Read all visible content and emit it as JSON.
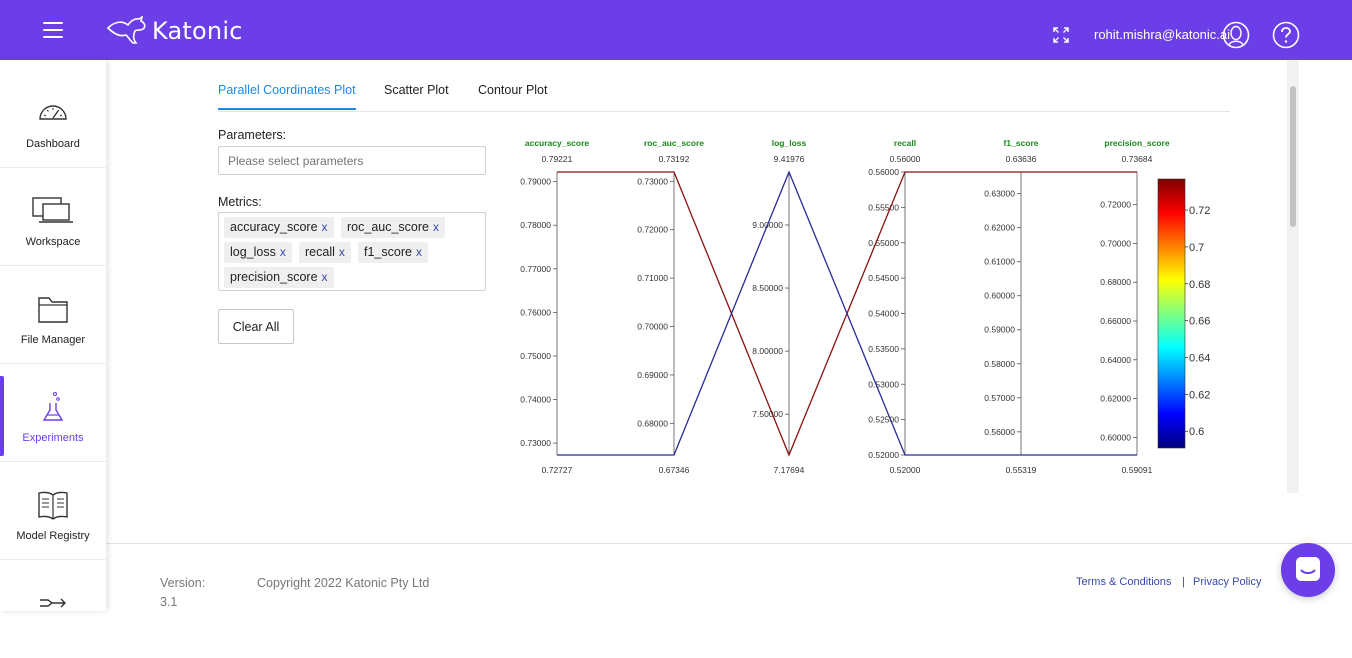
{
  "app": {
    "brand": "Katonic",
    "user_email": "rohit.mishra@katonic.ai",
    "accent_color": "#6c3ee8"
  },
  "icons": {
    "menu": "hamburger-icon",
    "expand": "fullscreen-icon",
    "user": "user-avatar-icon",
    "help": "question-icon",
    "chat": "chat-icon"
  },
  "sidebar": {
    "items": [
      {
        "label": "Dashboard",
        "icon": "gauge-icon",
        "active": false
      },
      {
        "label": "Workspace",
        "icon": "monitor-icon",
        "active": false
      },
      {
        "label": "File Manager",
        "icon": "folder-icon",
        "active": false
      },
      {
        "label": "Experiments",
        "icon": "flask-icon",
        "active": true
      },
      {
        "label": "Model Registry",
        "icon": "book-icon",
        "active": false
      }
    ]
  },
  "tabs": [
    {
      "label": "Parallel Coordinates Plot",
      "active": true
    },
    {
      "label": "Scatter Plot",
      "active": false
    },
    {
      "label": "Contour Plot",
      "active": false
    }
  ],
  "form": {
    "parameters_label": "Parameters:",
    "parameters_placeholder": "Please select parameters",
    "metrics_label": "Metrics:",
    "metrics": [
      "accuracy_score",
      "roc_auc_score",
      "log_loss",
      "recall",
      "f1_score",
      "precision_score"
    ],
    "chip_remove": "x",
    "clear_all": "Clear All"
  },
  "chart_data": {
    "type": "parallel_coordinates",
    "axes": [
      {
        "name": "accuracy_score",
        "max_label": "0.79221",
        "min_label": "0.72727",
        "range": [
          0.72727,
          0.79221
        ],
        "ticks": [
          "0.79000",
          "0.78000",
          "0.77000",
          "0.76000",
          "0.75000",
          "0.74000",
          "0.73000"
        ]
      },
      {
        "name": "roc_auc_score",
        "max_label": "0.73192",
        "min_label": "0.67346",
        "range": [
          0.67346,
          0.73192
        ],
        "ticks": [
          "0.73000",
          "0.72000",
          "0.71000",
          "0.70000",
          "0.69000",
          "0.68000"
        ]
      },
      {
        "name": "log_loss",
        "max_label": "9.41976",
        "min_label": "7.17694",
        "range": [
          7.17694,
          9.41976
        ],
        "ticks": [
          "9.00000",
          "8.50000",
          "8.00000",
          "7.50000"
        ]
      },
      {
        "name": "recall",
        "max_label": "0.56000",
        "min_label": "0.52000",
        "range": [
          0.52,
          0.56
        ],
        "ticks": [
          "0.56000",
          "0.55500",
          "0.55000",
          "0.54500",
          "0.54000",
          "0.53500",
          "0.53000",
          "0.52500",
          "0.52000"
        ]
      },
      {
        "name": "f1_score",
        "max_label": "0.63636",
        "min_label": "0.55319",
        "range": [
          0.55319,
          0.63636
        ],
        "ticks": [
          "0.63000",
          "0.62000",
          "0.61000",
          "0.60000",
          "0.59000",
          "0.58000",
          "0.57000",
          "0.56000"
        ]
      },
      {
        "name": "precision_score",
        "max_label": "0.73684",
        "min_label": "0.59091",
        "range": [
          0.59091,
          0.73684
        ],
        "ticks": [
          "0.72000",
          "0.70000",
          "0.68000",
          "0.66000",
          "0.64000",
          "0.62000",
          "0.60000"
        ]
      }
    ],
    "lines": [
      {
        "values": [
          0.79221,
          0.73192,
          7.17694,
          0.56,
          0.63636,
          0.73684
        ],
        "color": "#8b1010"
      },
      {
        "values": [
          0.72727,
          0.67346,
          9.41976,
          0.52,
          0.55319,
          0.59091
        ],
        "color": "#2a2a9a"
      }
    ],
    "colorbar": {
      "range": [
        0.59091,
        0.73684
      ],
      "ticks": [
        "0.72",
        "0.7",
        "0.68",
        "0.66",
        "0.64",
        "0.62",
        "0.6"
      ]
    }
  },
  "footer": {
    "version_label": "Version:",
    "version_value": "3.1",
    "copyright": "Copyright 2022 Katonic Pty Ltd",
    "terms": "Terms & Conditions",
    "separator": "|",
    "privacy": "Privacy Policy"
  }
}
